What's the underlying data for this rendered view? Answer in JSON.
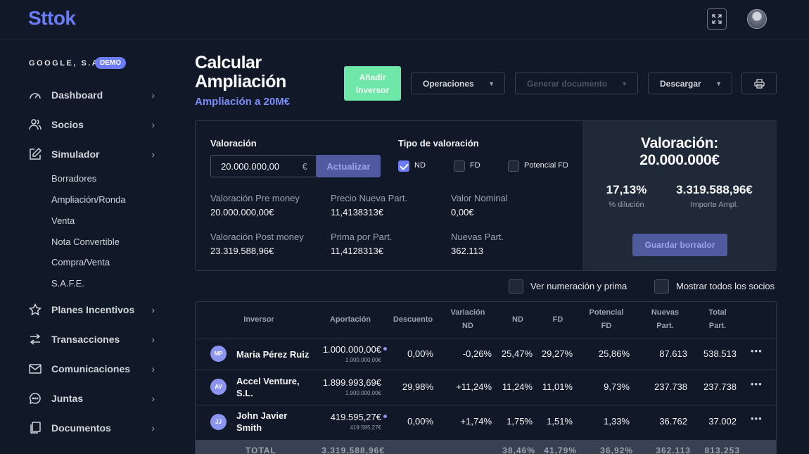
{
  "app": {
    "logo": "Sttok"
  },
  "topbar": {
    "expand_icon": "expand-icon",
    "avatar": "user-avatar"
  },
  "sidebar": {
    "company": "GOOGLE, S.A.",
    "badge": "DEMO",
    "items": [
      {
        "label": "Dashboard",
        "icon": "gauge-icon"
      },
      {
        "label": "Socios",
        "icon": "users-icon"
      },
      {
        "label": "Simulador",
        "icon": "edit-icon"
      },
      {
        "label": "Planes Incentivos",
        "icon": "star-icon"
      },
      {
        "label": "Transacciones",
        "icon": "arrows-icon"
      },
      {
        "label": "Comunicaciones",
        "icon": "mail-icon"
      },
      {
        "label": "Juntas",
        "icon": "chat-icon"
      },
      {
        "label": "Documentos",
        "icon": "documents-icon"
      }
    ],
    "sub_items": [
      "Borradores",
      "Ampliación/Ronda",
      "Venta",
      "Nota Convertible",
      "Compra/Venta",
      "S.A.F.E."
    ]
  },
  "header": {
    "title_line1": "Calcular",
    "title_line2": "Ampliación",
    "subtitle": "Ampliación a 20M€",
    "add_investor_line1": "Añadir",
    "add_investor_line2": "Inversor",
    "operations": "Operaciones",
    "generate_doc": "Generar documento",
    "download": "Descargar"
  },
  "valuation": {
    "label": "Valoración",
    "input_value": "20.000.000,00",
    "currency": "€",
    "update": "Actualizar",
    "type_label": "Tipo de valoración",
    "types": [
      {
        "label": "ND",
        "checked": true
      },
      {
        "label": "FD",
        "checked": false
      },
      {
        "label": "Potencial FD",
        "checked": false
      }
    ],
    "metrics": [
      {
        "label": "Valoración Pre money",
        "value": "20.000.000,00€"
      },
      {
        "label": "Precio Nueva Part.",
        "value": "11,4138313€"
      },
      {
        "label": "Valor Nominal",
        "value": "0,00€"
      },
      {
        "label": "Valoración Post money",
        "value": "23.319.588,96€"
      },
      {
        "label": "Prima por Part.",
        "value": "11,4128313€"
      },
      {
        "label": "Nuevas Part.",
        "value": "362.113"
      }
    ]
  },
  "summary": {
    "title_line1": "Valoración:",
    "title_line2": "20.000.000€",
    "dilution_value": "17,13%",
    "dilution_label": "% dilución",
    "amount_value": "3.319.588,96€",
    "amount_label": "Importe Ampl.",
    "save_draft": "Guardar borrador"
  },
  "options": {
    "show_numbering": "Ver numeración y prima",
    "show_all_partners": "Mostrar todos los socios"
  },
  "table": {
    "headers": {
      "inversor": "Inversor",
      "aportacion": "Aportación",
      "descuento": "Descuento",
      "variacion_1": "Variación",
      "variacion_2": "ND",
      "nd": "ND",
      "fd": "FD",
      "potencial_1": "Potencial",
      "potencial_2": "FD",
      "nuevas_1": "Nuevas",
      "nuevas_2": "Part.",
      "total_1": "Total",
      "total_2": "Part."
    },
    "rows": [
      {
        "initials": "MP",
        "name": "Maria Pérez Ruiz",
        "aportacion": "1.000.000,00€",
        "aportacion_sub": "1.000.000,00€",
        "descuento": "0,00%",
        "variacion": "-0,26%",
        "nd": "25,47%",
        "fd": "29,27%",
        "potencial": "25,86%",
        "nuevas": "87.613",
        "total": "538.513"
      },
      {
        "initials": "AV",
        "name": "Accel Venture, S.L.",
        "aportacion": "1.899.993,69€",
        "aportacion_sub": "1.900.000,00€",
        "descuento": "29,98%",
        "variacion": "+11,24%",
        "nd": "11,24%",
        "fd": "11,01%",
        "potencial": "9,73%",
        "nuevas": "237.738",
        "total": "237.738"
      },
      {
        "initials": "JJ",
        "name": "John Javier Smith",
        "aportacion": "419.595,27€",
        "aportacion_sub": "419.595,27€",
        "descuento": "0,00%",
        "variacion": "+1,74%",
        "nd": "1,75%",
        "fd": "1,51%",
        "potencial": "1,33%",
        "nuevas": "36.762",
        "total": "37.002"
      }
    ],
    "more": "•••",
    "total": {
      "label": "TOTAL",
      "aportacion": "3.319.588,96€",
      "nd": "38,46%",
      "fd": "41,79%",
      "potencial": "36,92%",
      "nuevas": "362.113",
      "total": "813.253"
    }
  },
  "colors": {
    "accent": "#6b7cf6",
    "green": "#6ee7a8",
    "background": "#111827"
  }
}
